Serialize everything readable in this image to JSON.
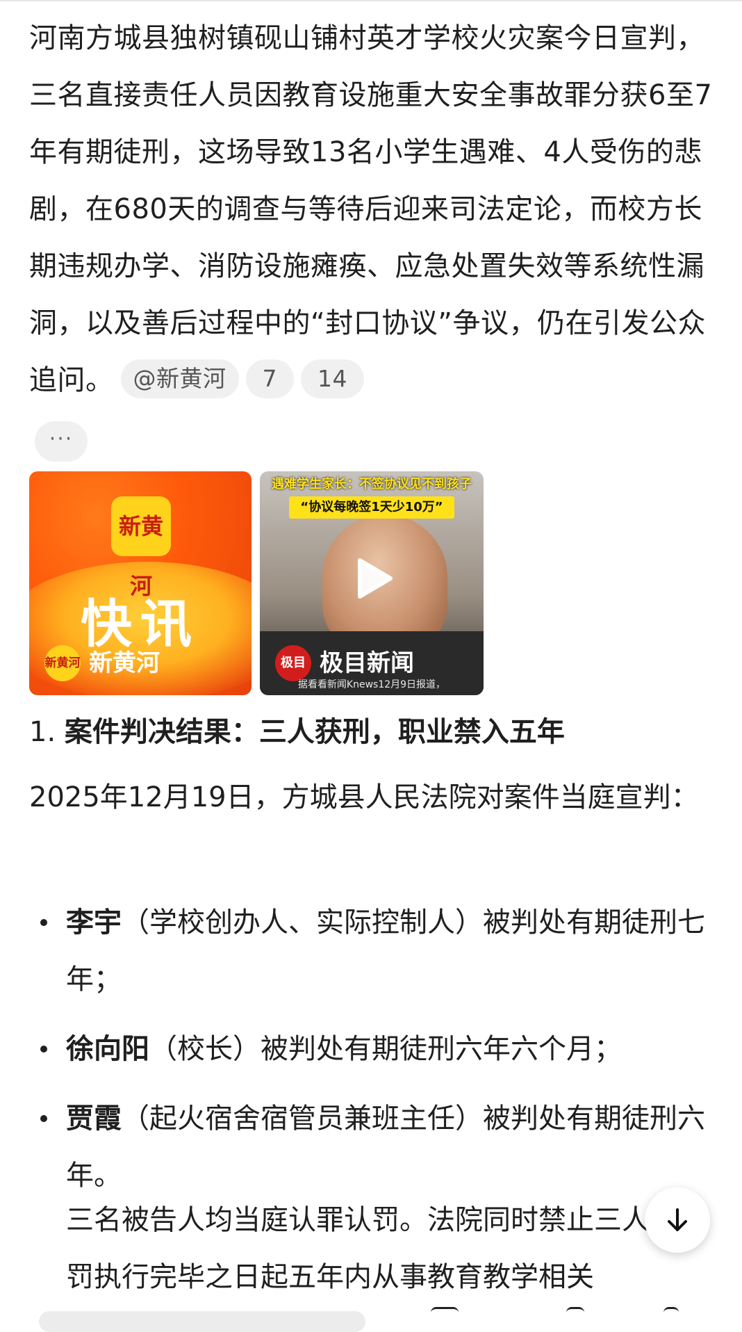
{
  "intro": {
    "text": "河南方城县独树镇砚山铺村英才学校火灾案今日宣判，三名直接责任人员因教育设施重大安全事故罪分获6至7年有期徒刑，这场导致13名小学生遇难、4人受伤的悲剧，在680天的调查与等待后迎来司法定论，而校方长期违规办学、消防设施瘫痪、应急处置失效等系统性漏洞，以及善后过程中的“封口协议”争议，仍在引发公众追问。",
    "source_chip": "@新黄河",
    "count_chip_1": "7",
    "count_chip_2": "14",
    "more_chip": "···"
  },
  "media": {
    "card1": {
      "logo_text": "新黄河",
      "headline": "快讯",
      "source_name": "新黄河"
    },
    "card2": {
      "caption_top": "遇难学生家长：不签协议见不到孩子",
      "caption_quote": "“协议每晚签1天少10万”",
      "logo_text": "极目",
      "source_name": "极目新闻",
      "footnote": "据看看新闻Knews12月9日报道，"
    }
  },
  "section1": {
    "number": "1.",
    "title": "案件判决结果：三人获刑，职业禁入五年",
    "lead": "2025年12月19日，方城县人民法院对案件当庭宣判："
  },
  "verdicts": [
    {
      "name": "李宇",
      "text": "（学校创办人、实际控制人）被判处有期徒刑七年；"
    },
    {
      "name": "徐向阳",
      "text": "（校长）被判处有期徒刑六年六个月；"
    },
    {
      "name": "贾霞",
      "text": "（起火宿舍宿管员兼班主任）被判处有期徒刑六年。"
    }
  ],
  "note": "三名被告人均当庭认罪认罚。法院同时禁止三人自刑罚执行完毕之日起五年内从事教育教学相关",
  "icons": {
    "scroll": "arrow-down-icon",
    "play": "play-icon"
  }
}
